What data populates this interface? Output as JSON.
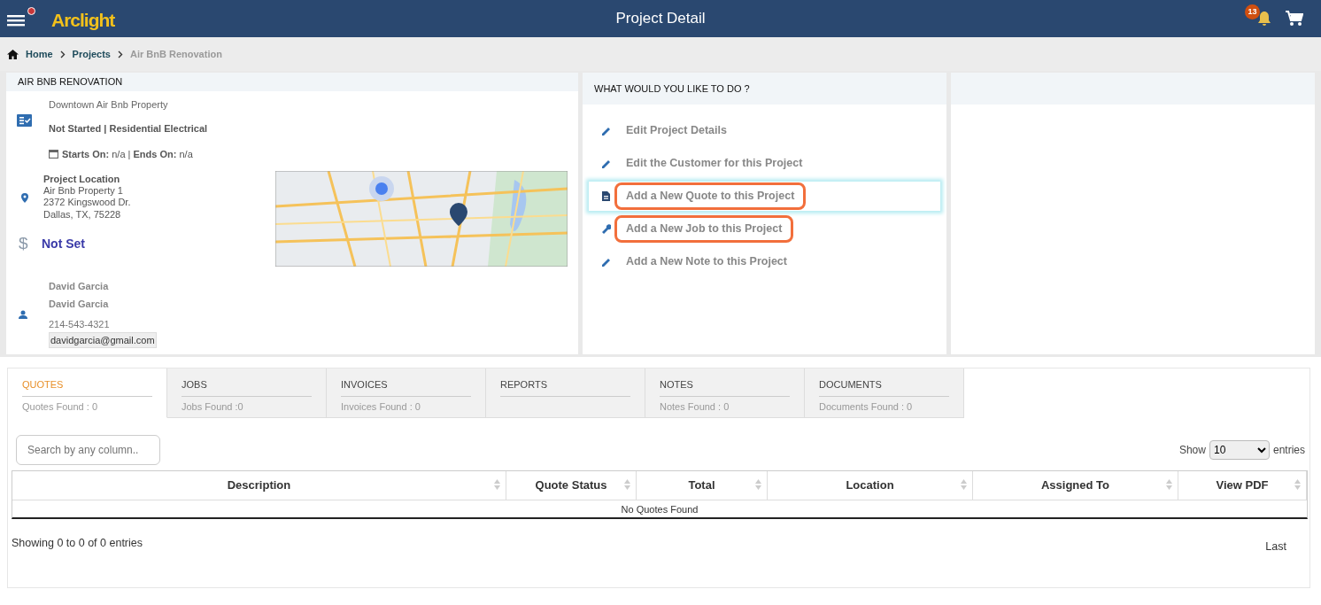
{
  "header": {
    "title": "Project Detail",
    "logo": "Arclight",
    "notification_count": "13",
    "menu_alert": true
  },
  "breadcrumb": [
    {
      "label": "Home",
      "current": false
    },
    {
      "label": "Projects",
      "current": false
    },
    {
      "label": "Air BnB Renovation",
      "current": true
    }
  ],
  "project": {
    "heading": "AIR BNB RENOVATION",
    "name": "Downtown Air Bnb Property",
    "status": "Not Started | Residential Electrical",
    "schedule": "**Starts On:** n/a | **Ends On:** n/a",
    "location_label": "Project Location",
    "location_lines": [
      "Air Bnb Property 1",
      "2372 Kingswood Dr.",
      "Dallas, TX, 75228"
    ],
    "currency_symbol": "$",
    "budget": "Not Set",
    "contact": {
      "lines": [
        "David Garcia",
        "David Garcia"
      ],
      "phone": "214-543-4321",
      "email": "davidgarcia@gmail.com"
    }
  },
  "actions": {
    "heading": "WHAT WOULD YOU LIKE TO DO ?",
    "items": [
      {
        "label": "Edit Project Details",
        "kind": "edit",
        "focused": false,
        "highlighted": false
      },
      {
        "label": "Edit the Customer for this Project",
        "kind": "edit",
        "focused": false,
        "highlighted": false
      },
      {
        "label": "Add a New Quote to this Project",
        "kind": "document",
        "focused": true,
        "highlighted": true
      },
      {
        "label": "Add a New Job to this Project",
        "kind": "tool",
        "focused": false,
        "highlighted": true
      },
      {
        "label": "Add a New Note to this Project",
        "kind": "edit",
        "focused": false,
        "highlighted": false
      }
    ]
  },
  "tabs": [
    {
      "label": "QUOTES",
      "count": "Quotes Found : 0",
      "selected": true
    },
    {
      "label": "JOBS",
      "count": "Jobs Found :0",
      "selected": false
    },
    {
      "label": "INVOICES",
      "count": "Invoices Found : 0",
      "selected": false
    },
    {
      "label": "REPORTS",
      "selected": false
    },
    {
      "label": "NOTES",
      "count": "Notes Found : 0",
      "selected": false
    },
    {
      "label": "DOCUMENTS",
      "count": "Documents Found : 0",
      "selected": false
    }
  ],
  "table": {
    "search": {
      "placeholder": "Search by any column.."
    },
    "show_label": "Show",
    "page_size": "10",
    "entries_label": "entries",
    "columns": [
      "Description",
      "Quote Status",
      "Total",
      "Location",
      "Assigned To",
      "View PDF"
    ],
    "empty_message": "No Quotes Found",
    "info": "Showing 0 to 0 of 0 entries",
    "last": "Last"
  }
}
